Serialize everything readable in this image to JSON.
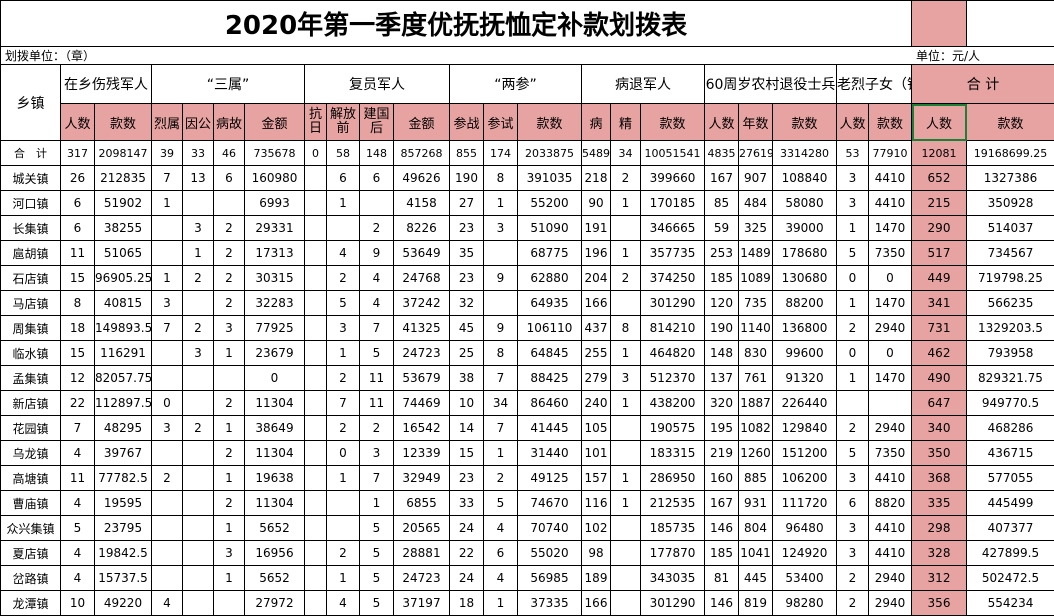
{
  "title": "2020年第一季度优抚抚恤定补款划拨表",
  "unit_left": "划拨单位：（章）",
  "unit_right": "单位：元/人",
  "headers": {
    "town": "乡镇",
    "g1": "在乡伤残军人",
    "g2": "“三属”",
    "g3": "复员军人",
    "g4": "“两参”",
    "g5": "病退军人",
    "g6": "60周岁农村退役士兵",
    "g7": "老烈子女（错杀平反人员）",
    "g8": "合 计",
    "sub": [
      "人数",
      "款数",
      "烈属",
      "因公",
      "病故",
      "金额",
      "抗日",
      "解放前",
      "建国后",
      "金额",
      "参战",
      "参试",
      "款数",
      "病",
      "精",
      "款数",
      "人数",
      "年数",
      "款数",
      "人数",
      "款数",
      "人数",
      "款数"
    ]
  },
  "rows": [
    [
      "合　计",
      "317",
      "2098147",
      "39",
      "33",
      "46",
      "735678",
      "0",
      "58",
      "148",
      "857268",
      "855",
      "174",
      "2033875",
      "5489",
      "34",
      "10051541",
      "4835",
      "27619",
      "3314280",
      "53",
      "77910",
      "12081",
      "19168699.25"
    ],
    [
      "城关镇",
      "26",
      "212835",
      "7",
      "13",
      "6",
      "160980",
      "",
      "6",
      "6",
      "49626",
      "190",
      "8",
      "391035",
      "218",
      "2",
      "399660",
      "167",
      "907",
      "108840",
      "3",
      "4410",
      "652",
      "1327386"
    ],
    [
      "河口镇",
      "6",
      "51902",
      "1",
      "",
      "",
      "6993",
      "",
      "1",
      "",
      "4158",
      "27",
      "1",
      "55200",
      "90",
      "1",
      "170185",
      "85",
      "484",
      "58080",
      "3",
      "4410",
      "215",
      "350928"
    ],
    [
      "长集镇",
      "6",
      "38255",
      "",
      "3",
      "2",
      "29331",
      "",
      "",
      "2",
      "8226",
      "23",
      "3",
      "51090",
      "191",
      "",
      "346665",
      "59",
      "325",
      "39000",
      "1",
      "1470",
      "290",
      "514037"
    ],
    [
      "扈胡镇",
      "11",
      "51065",
      "",
      "1",
      "2",
      "17313",
      "",
      "4",
      "9",
      "53649",
      "35",
      "",
      "68775",
      "196",
      "1",
      "357735",
      "253",
      "1489",
      "178680",
      "5",
      "7350",
      "517",
      "734567"
    ],
    [
      "石店镇",
      "15",
      "96905.25",
      "1",
      "2",
      "2",
      "30315",
      "",
      "2",
      "4",
      "24768",
      "23",
      "9",
      "62880",
      "204",
      "2",
      "374250",
      "185",
      "1089",
      "130680",
      "0",
      "0",
      "449",
      "719798.25"
    ],
    [
      "马店镇",
      "8",
      "40815",
      "3",
      "",
      "2",
      "32283",
      "",
      "5",
      "4",
      "37242",
      "32",
      "",
      "64935",
      "166",
      "",
      "301290",
      "120",
      "735",
      "88200",
      "1",
      "1470",
      "341",
      "566235"
    ],
    [
      "周集镇",
      "18",
      "149893.5",
      "7",
      "2",
      "3",
      "77925",
      "",
      "3",
      "7",
      "41325",
      "45",
      "9",
      "106110",
      "437",
      "8",
      "814210",
      "190",
      "1140",
      "136800",
      "2",
      "2940",
      "731",
      "1329203.5"
    ],
    [
      "临水镇",
      "15",
      "116291",
      "",
      "3",
      "1",
      "23679",
      "",
      "1",
      "5",
      "24723",
      "25",
      "8",
      "64845",
      "255",
      "1",
      "464820",
      "148",
      "830",
      "99600",
      "0",
      "0",
      "462",
      "793958"
    ],
    [
      "孟集镇",
      "12",
      "82057.75",
      "",
      "",
      "",
      "0",
      "",
      "2",
      "11",
      "53679",
      "38",
      "7",
      "88425",
      "279",
      "3",
      "512370",
      "137",
      "761",
      "91320",
      "1",
      "1470",
      "490",
      "829321.75"
    ],
    [
      "新店镇",
      "22",
      "112897.5",
      "0",
      "",
      "2",
      "11304",
      "",
      "7",
      "11",
      "74469",
      "10",
      "34",
      "86460",
      "240",
      "1",
      "438200",
      "320",
      "1887",
      "226440",
      "",
      "",
      "647",
      "949770.5"
    ],
    [
      "花园镇",
      "7",
      "48295",
      "3",
      "2",
      "1",
      "38649",
      "",
      "2",
      "2",
      "16542",
      "14",
      "7",
      "41445",
      "105",
      "",
      "190575",
      "195",
      "1082",
      "129840",
      "2",
      "2940",
      "340",
      "468286"
    ],
    [
      "乌龙镇",
      "4",
      "39767",
      "",
      "",
      "2",
      "11304",
      "",
      "0",
      "3",
      "12339",
      "15",
      "1",
      "31440",
      "101",
      "",
      "183315",
      "219",
      "1260",
      "151200",
      "5",
      "7350",
      "350",
      "436715"
    ],
    [
      "高塘镇",
      "11",
      "77782.5",
      "2",
      "",
      "1",
      "19638",
      "",
      "1",
      "7",
      "32949",
      "23",
      "2",
      "49125",
      "157",
      "1",
      "286950",
      "160",
      "885",
      "106200",
      "3",
      "4410",
      "368",
      "577055"
    ],
    [
      "曹庙镇",
      "4",
      "19595",
      "",
      "",
      "2",
      "11304",
      "",
      "",
      "1",
      "6855",
      "33",
      "5",
      "74670",
      "116",
      "1",
      "212535",
      "167",
      "931",
      "111720",
      "6",
      "8820",
      "335",
      "445499"
    ],
    [
      "众兴集镇",
      "5",
      "23795",
      "",
      "",
      "1",
      "5652",
      "",
      "",
      "5",
      "20565",
      "24",
      "4",
      "70740",
      "102",
      "",
      "185735",
      "146",
      "804",
      "96480",
      "3",
      "4410",
      "298",
      "407377"
    ],
    [
      "夏店镇",
      "4",
      "19842.5",
      "",
      "",
      "3",
      "16956",
      "",
      "2",
      "5",
      "28881",
      "22",
      "6",
      "55020",
      "98",
      "",
      "177870",
      "185",
      "1041",
      "124920",
      "3",
      "4410",
      "328",
      "427899.5"
    ],
    [
      "岔路镇",
      "4",
      "15737.5",
      "",
      "",
      "1",
      "5652",
      "",
      "1",
      "5",
      "24723",
      "24",
      "4",
      "56985",
      "189",
      "",
      "343035",
      "81",
      "445",
      "53400",
      "2",
      "2940",
      "312",
      "502472.5"
    ],
    [
      "龙潭镇",
      "10",
      "49220",
      "4",
      "",
      "",
      "27972",
      "",
      "4",
      "5",
      "37197",
      "18",
      "1",
      "37335",
      "166",
      "",
      "301290",
      "146",
      "819",
      "98280",
      "2",
      "2940",
      "356",
      "554234"
    ]
  ]
}
